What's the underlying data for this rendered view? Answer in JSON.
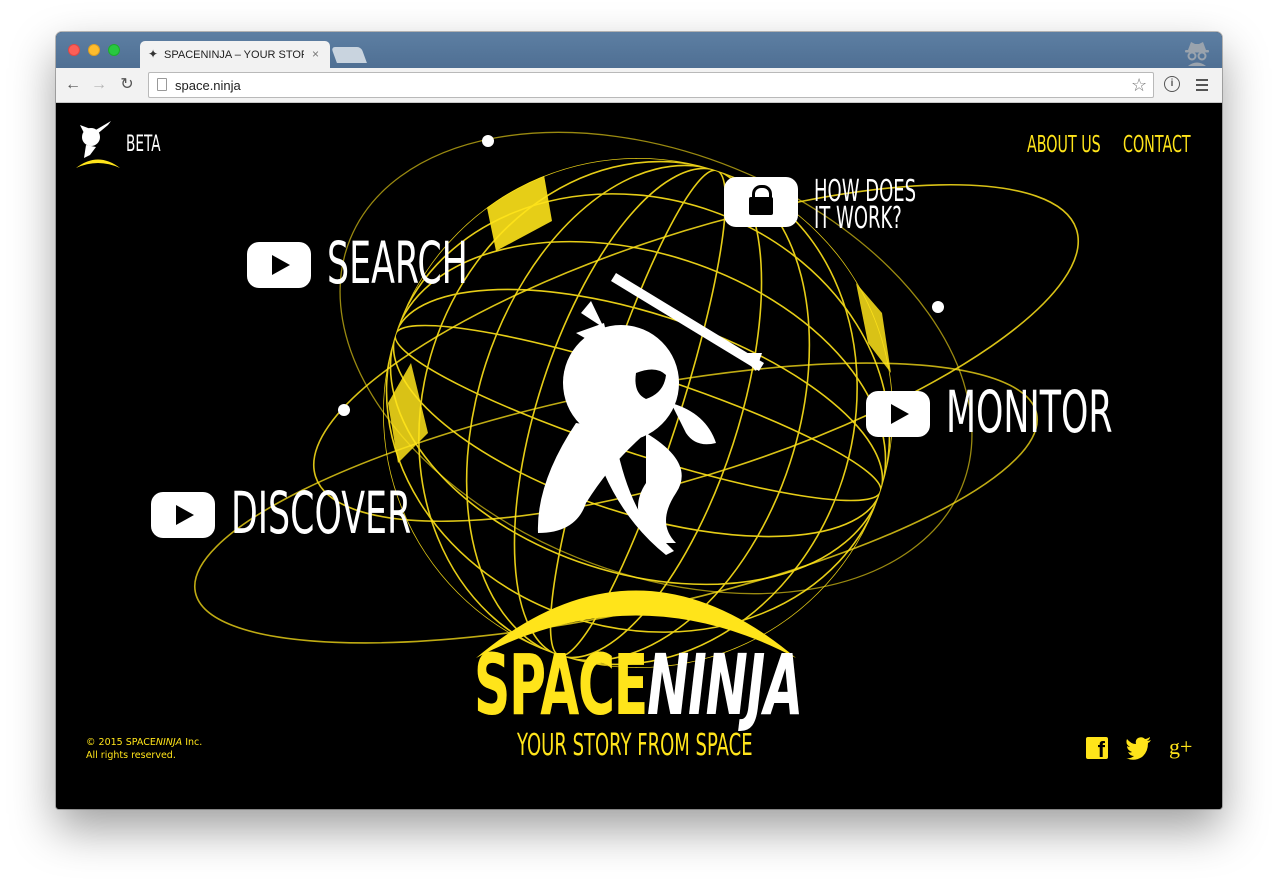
{
  "browser": {
    "tab_title": "SPACENINJA – YOUR STORY FROM SPACE",
    "tab_favicon": "ninja-favicon-icon",
    "tab_close": "×",
    "url": "space.ninja",
    "back_glyph": "←",
    "forward_glyph": "→",
    "reload_glyph": "↻",
    "bookmark_glyph": "☆",
    "info_glyph": "i"
  },
  "header": {
    "beta_label": "BETA",
    "nav": [
      {
        "label": "ABOUT US"
      },
      {
        "label": "CONTACT"
      }
    ]
  },
  "features": {
    "search": "SEARCH",
    "discover": "DISCOVER",
    "monitor": "MONITOR",
    "how_line1": "HOW DOES",
    "how_line2": "IT WORK?"
  },
  "logo": {
    "part1": "SPACE",
    "part2": "NINJA",
    "tagline": "YOUR STORY FROM SPACE"
  },
  "footer": {
    "copyright_prefix": "© 2015 SPACE",
    "copyright_ninja": "NINJA",
    "copyright_suffix": " Inc.",
    "rights": "All rights reserved.",
    "social": [
      {
        "icon": "facebook-icon",
        "glyph": "f"
      },
      {
        "icon": "twitter-icon"
      },
      {
        "icon": "google-plus-icon",
        "glyph": "g+"
      }
    ]
  },
  "colors": {
    "accent": "#ffe41a",
    "background": "#000000",
    "text": "#ffffff"
  }
}
